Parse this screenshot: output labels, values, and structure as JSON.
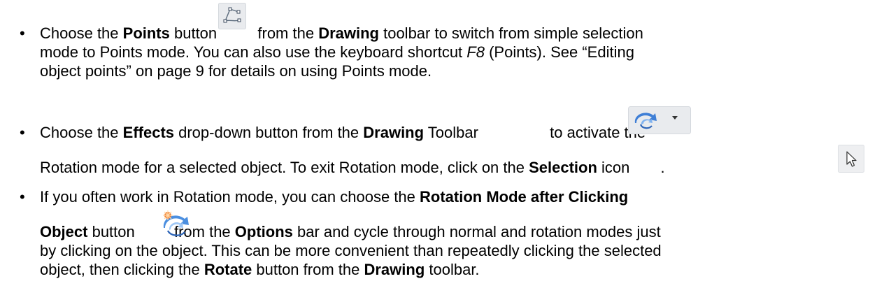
{
  "bullets": [
    {
      "lines": [
        {
          "t1": "Choose the ",
          "points": "Points",
          "t2": " button ",
          "t3": " from the ",
          "drawing": "Drawing",
          "t4": " toolbar to switch from simple selection"
        },
        {
          "t1": "mode to Points mode. You can also use the keyboard shortcut ",
          "key": "F8",
          "t2": " (Points). See “Editing"
        },
        {
          "t1": "object points” on page 9 for details on using Points mode."
        }
      ]
    },
    {
      "lines": [
        {
          "t1": "Choose the ",
          "effects": "Effects",
          "t2": " drop-down button from the ",
          "drawing": "Drawing",
          "t3": " Toolbar ",
          "t4": " to activate the"
        },
        {
          "t1": "Rotation mode for a selected object. To exit Rotation mode, click on the ",
          "selection": "Selection",
          "t2": " icon ",
          "t3": "."
        }
      ]
    },
    {
      "lines": [
        {
          "t1": "If you often work in Rotation mode, you can choose the ",
          "rot": "Rotation Mode after Clicking"
        },
        {
          "object": "Object",
          "t1": " button ",
          "t2": " from the ",
          "options": "Options",
          "t3": " bar and cycle through normal and rotation modes just"
        },
        {
          "t1": "by clicking on the object. This can be more convenient than repeatedly clicking the selected"
        },
        {
          "t1": "object, then clicking the ",
          "rotate": "Rotate",
          "t2": " button from the ",
          "drawing": "Drawing",
          "t3": " toolbar."
        }
      ]
    }
  ],
  "icons": {
    "points": "points-mode-icon",
    "effects": "rotate-effects-icon",
    "dropdown": "chevron-down-icon",
    "selection": "selection-arrow-icon",
    "rotation_after_click": "rotation-mode-after-clicking-icon"
  },
  "colors": {
    "text": "#000000",
    "icon_bg": "#e9ebee",
    "icon_stroke": "#5a6a7c",
    "effects_blue": "#3f7fd6",
    "rotation_orange": "#f07a2a"
  }
}
